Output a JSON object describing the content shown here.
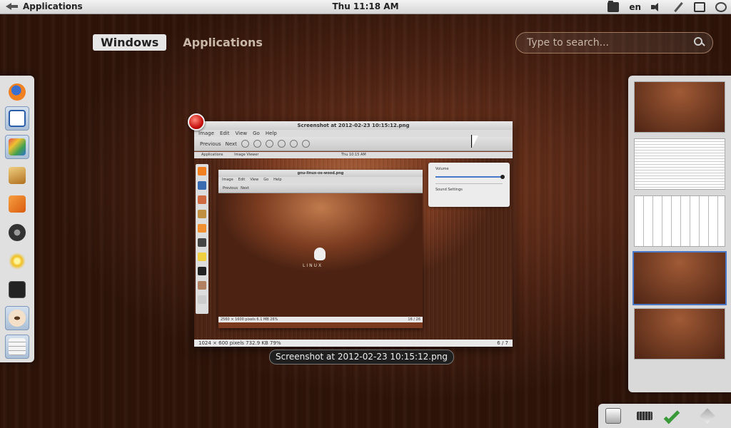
{
  "top_panel": {
    "app_menu_label": "Applications",
    "clock": "Thu 11:18 AM",
    "language": "en",
    "icons": [
      "folder-icon",
      "volume-icon",
      "pen-icon",
      "battery-icon",
      "power-icon"
    ]
  },
  "overview": {
    "tabs": [
      {
        "label": "Windows",
        "active": true
      },
      {
        "label": "Applications",
        "active": false
      }
    ],
    "search_placeholder": "Type to search..."
  },
  "dash": {
    "items": [
      "firefox-icon",
      "writer-icon",
      "photos-icon",
      "text-editor-icon",
      "rss-icon",
      "camera-icon",
      "star-icon",
      "terminal-icon",
      "eye-of-gnome-icon",
      "files-icon"
    ]
  },
  "window_thumbnail": {
    "title": "Screenshot at 2012-02-23 10:15:12.png",
    "menu": [
      "Image",
      "Edit",
      "View",
      "Go",
      "Help"
    ],
    "toolbar": {
      "previous": "Previous",
      "next": "Next"
    },
    "inner_panel": {
      "apps": "Applications",
      "app_name": "Image Viewer",
      "clock": "Thu 10:15 AM"
    },
    "inner_window": {
      "title": "gnu-linux-os-wood.png",
      "menu": [
        "Image",
        "Edit",
        "View",
        "Go",
        "Help"
      ],
      "toolbar": {
        "previous": "Previous",
        "next": "Next"
      },
      "status_left": "2560 × 1600 pixels   6.1 MB   26%",
      "status_right": "16 / 26",
      "logo_text": "LINUX"
    },
    "volume_popup": {
      "label": "Volume",
      "settings": "Sound Settings"
    },
    "status_left": "1024 × 600 pixels   732.9 KB   79%",
    "status_right": "6 / 7"
  },
  "caption": "Screenshot at 2012-02-23 10:15:12.png",
  "workspaces": {
    "count": 5,
    "active_index": 3
  },
  "bottom_tray": {
    "icons": [
      "eject-icon",
      "keyboard-icon",
      "check-icon",
      "layers-icon"
    ]
  },
  "colors": {
    "accent": "#4a78c8",
    "close_red": "#c8120f",
    "panel_bg": "#dedede"
  }
}
